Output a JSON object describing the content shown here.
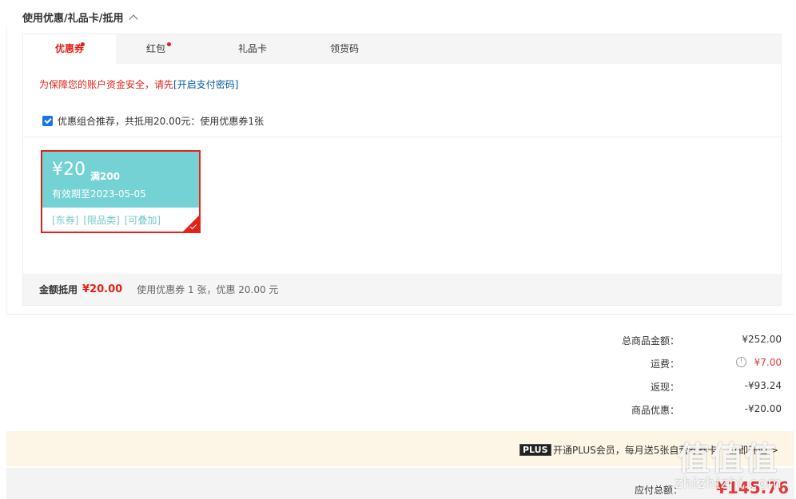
{
  "section": {
    "title": "使用优惠/礼品卡/抵用"
  },
  "tabs": [
    {
      "label": "优惠券",
      "active": true,
      "dot": true
    },
    {
      "label": "红包",
      "active": false,
      "dot": true
    },
    {
      "label": "礼品卡",
      "active": false,
      "dot": false
    },
    {
      "label": "领货码",
      "active": false,
      "dot": false
    }
  ],
  "warning": {
    "text": "为保障您的账户资金安全，请先",
    "link": "[开启支付密码]"
  },
  "recommend": {
    "checked": true,
    "text": "优惠组合推荐，共抵用20.00元：使用优惠券1张"
  },
  "coupon": {
    "amount": "¥20",
    "condition": "满200",
    "expiry": "有效期至2023-05-05",
    "tags": [
      "[东券]",
      "[限品类]",
      "[可叠加]"
    ],
    "selected": true
  },
  "deduction": {
    "label": "金额抵用",
    "value": "¥20.00",
    "desc": "使用优惠券 1 张，优惠 20.00 元"
  },
  "totals": [
    {
      "label": "总商品金额：",
      "value": "¥252.00",
      "red": false,
      "info": false
    },
    {
      "label": "运费：",
      "value": "¥7.00",
      "red": true,
      "info": true
    },
    {
      "label": "返现：",
      "value": "-¥93.24",
      "red": false,
      "info": false
    },
    {
      "label": "商品优惠：",
      "value": "-¥20.00",
      "red": false,
      "info": false
    }
  ],
  "plus": {
    "badge": "PLUS",
    "text": "开通PLUS会员，每月送5张自营券券卡",
    "more": "立即开通 >"
  },
  "pay": {
    "label": "应付总额：",
    "value": "¥145.76"
  },
  "watermark": {
    "logo": "值值值",
    "site": "zhizhizhi.com"
  },
  "colors": {
    "accent": "#e2231a",
    "coupon": "#74d2d4",
    "link": "#005aa0"
  }
}
